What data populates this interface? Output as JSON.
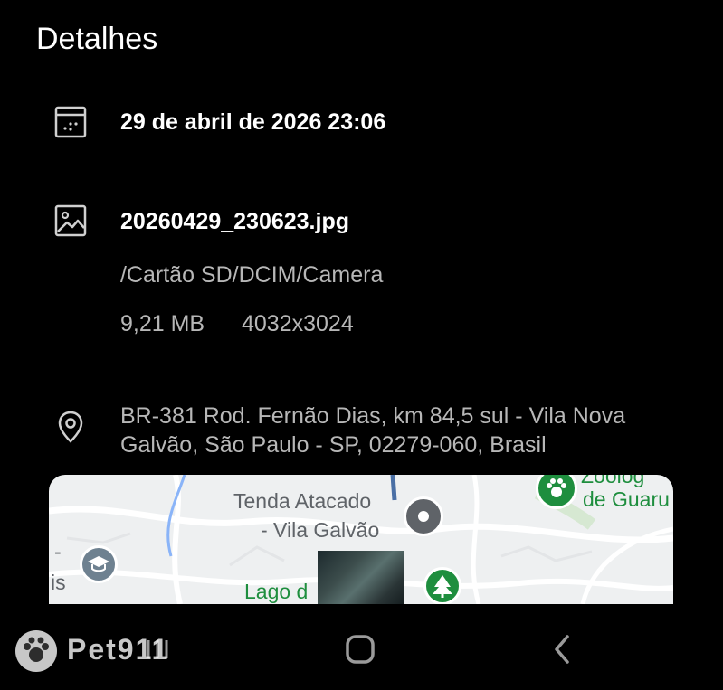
{
  "header": {
    "title": "Detalhes"
  },
  "date_row": {
    "icon": "calendar-icon",
    "datetime": "29 de abril de 2026 23:06"
  },
  "file_row": {
    "icon": "image-icon",
    "filename": "20260429_230623.jpg",
    "path": "/Cartão SD/DCIM/Camera",
    "size": "9,21 MB",
    "resolution": "4032x3024"
  },
  "location_row": {
    "icon": "location-pin-icon",
    "address": "BR-381 Rod. Fernão Dias, km 84,5 sul - Vila Nova Galvão, São Paulo - SP, 02279-060, Brasil"
  },
  "map": {
    "labels": {
      "store": "Tenda Atacado",
      "store_line2": "- Vila Galvão",
      "lake": "Lago d",
      "zoo_line1": "Zoológ",
      "zoo_line2": "de Guaru",
      "left_edge_1": "-",
      "left_edge_2": "is"
    },
    "colors": {
      "background": "#eef0f1",
      "road": "#ffffff",
      "water": "#8ab4f8",
      "park": "#1e8e3e",
      "place": "#5f6368",
      "road_blue": "#4a6fa5"
    }
  },
  "navbar": {
    "recent_icon": "recent-apps-icon",
    "home_icon": "home-icon",
    "back_icon": "back-icon"
  },
  "watermark": {
    "text": "Pet911",
    "logo": "paw-logo"
  }
}
